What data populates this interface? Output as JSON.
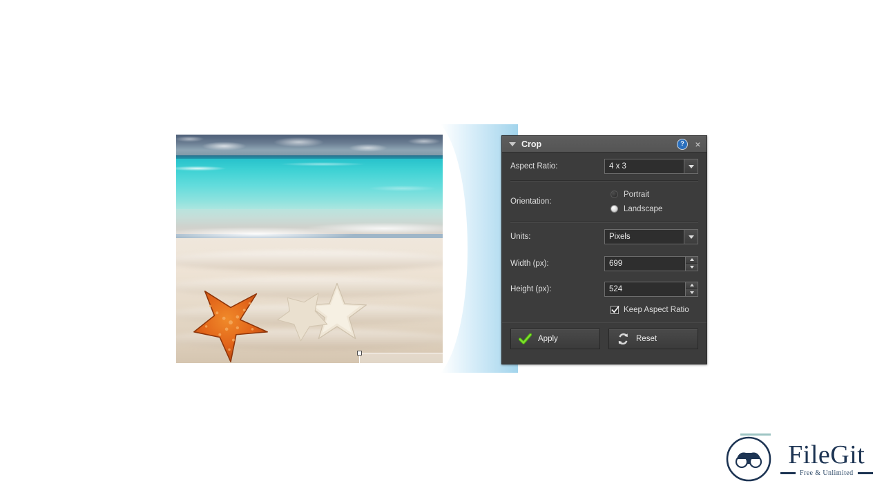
{
  "panel": {
    "title": "Crop",
    "collapse_icon": "triangle-down-icon",
    "help_icon": "?",
    "close_icon": "×",
    "fields": {
      "aspect_ratio_label": "Aspect Ratio:",
      "aspect_ratio_value": "4 x 3",
      "orientation_label": "Orientation:",
      "orientation_portrait": "Portrait",
      "orientation_landscape": "Landscape",
      "orientation_selected": "Landscape",
      "units_label": "Units:",
      "units_value": "Pixels",
      "width_label": "Width (px):",
      "width_value": "699",
      "height_label": "Height (px):",
      "height_value": "524",
      "keep_aspect_label": "Keep Aspect Ratio",
      "keep_aspect_checked": true
    },
    "buttons": {
      "apply_label": "Apply",
      "apply_icon": "green-check-icon",
      "reset_label": "Reset",
      "reset_icon": "refresh-arrows-icon"
    }
  },
  "canvas": {
    "image_alt": "beach-starfish-photo",
    "crop_selection": {
      "handles": 8,
      "handle_icon": "resize-handle"
    }
  },
  "branding": {
    "name": "FileGit",
    "tagline": "Free & Unlimited",
    "mark_icon": "binoculars-circle-logo"
  },
  "colors": {
    "panel_bg": "#3c3c3c",
    "panel_title_bg": "#5a5a5a",
    "field_bg": "#2e2e2e",
    "accent_green": "#5fc31f",
    "help_blue": "#2a6fbd",
    "logo_navy": "#1d3453",
    "swoosh_blue": "#a8d8ee"
  }
}
